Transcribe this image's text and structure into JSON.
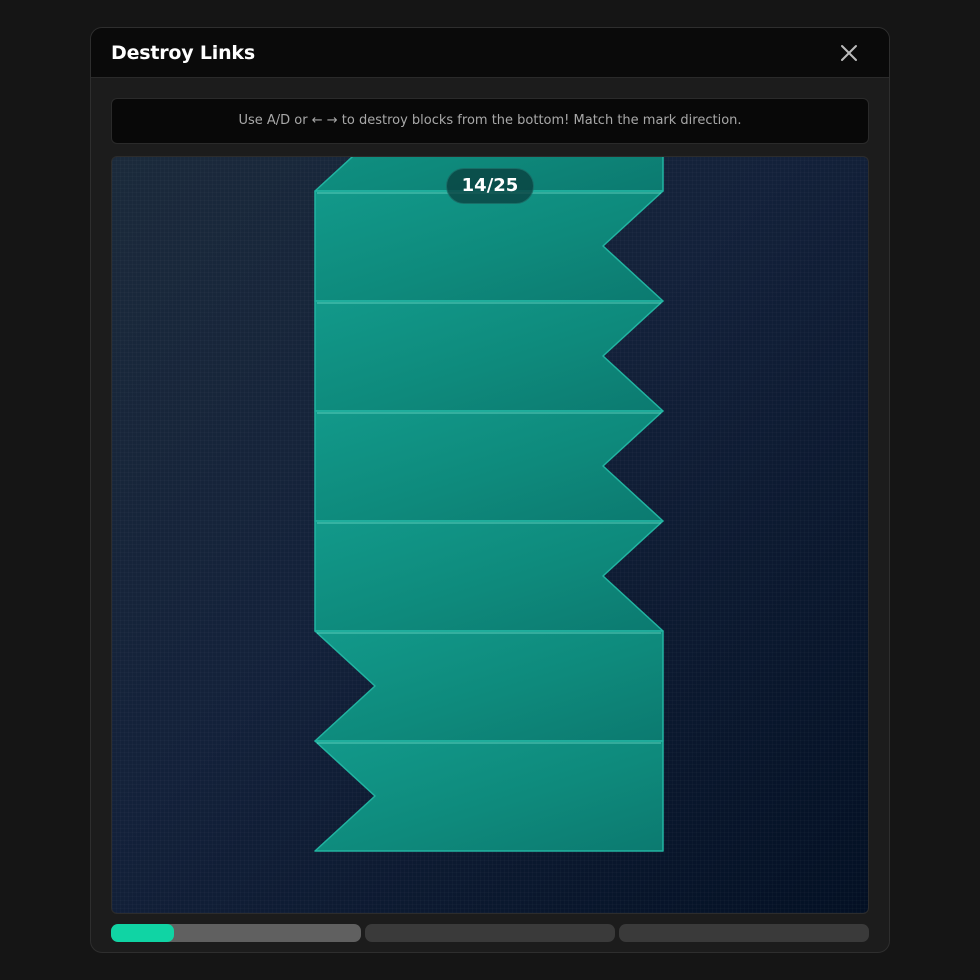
{
  "window": {
    "title": "Destroy Links"
  },
  "instructions": "Use A/D or ← → to destroy blocks from the bottom! Match the mark direction.",
  "counter": {
    "text": "14/25",
    "current": 14,
    "total": 25
  },
  "stack": {
    "block_color": "#0f8b7d",
    "block_edge_color": "#22b4a2",
    "blocks_top_to_bottom": [
      "left",
      "right",
      "right",
      "right",
      "right",
      "left",
      "left"
    ]
  },
  "stages": [
    {
      "progress": 0.25,
      "active": true
    },
    {
      "progress": 0,
      "active": false
    },
    {
      "progress": 0,
      "active": false
    }
  ],
  "colors": {
    "accent": "#10d4a4",
    "header_bg": "#0a0a0a",
    "modal_bg": "#1c1c1c"
  },
  "icons": {
    "close": "close-icon"
  }
}
